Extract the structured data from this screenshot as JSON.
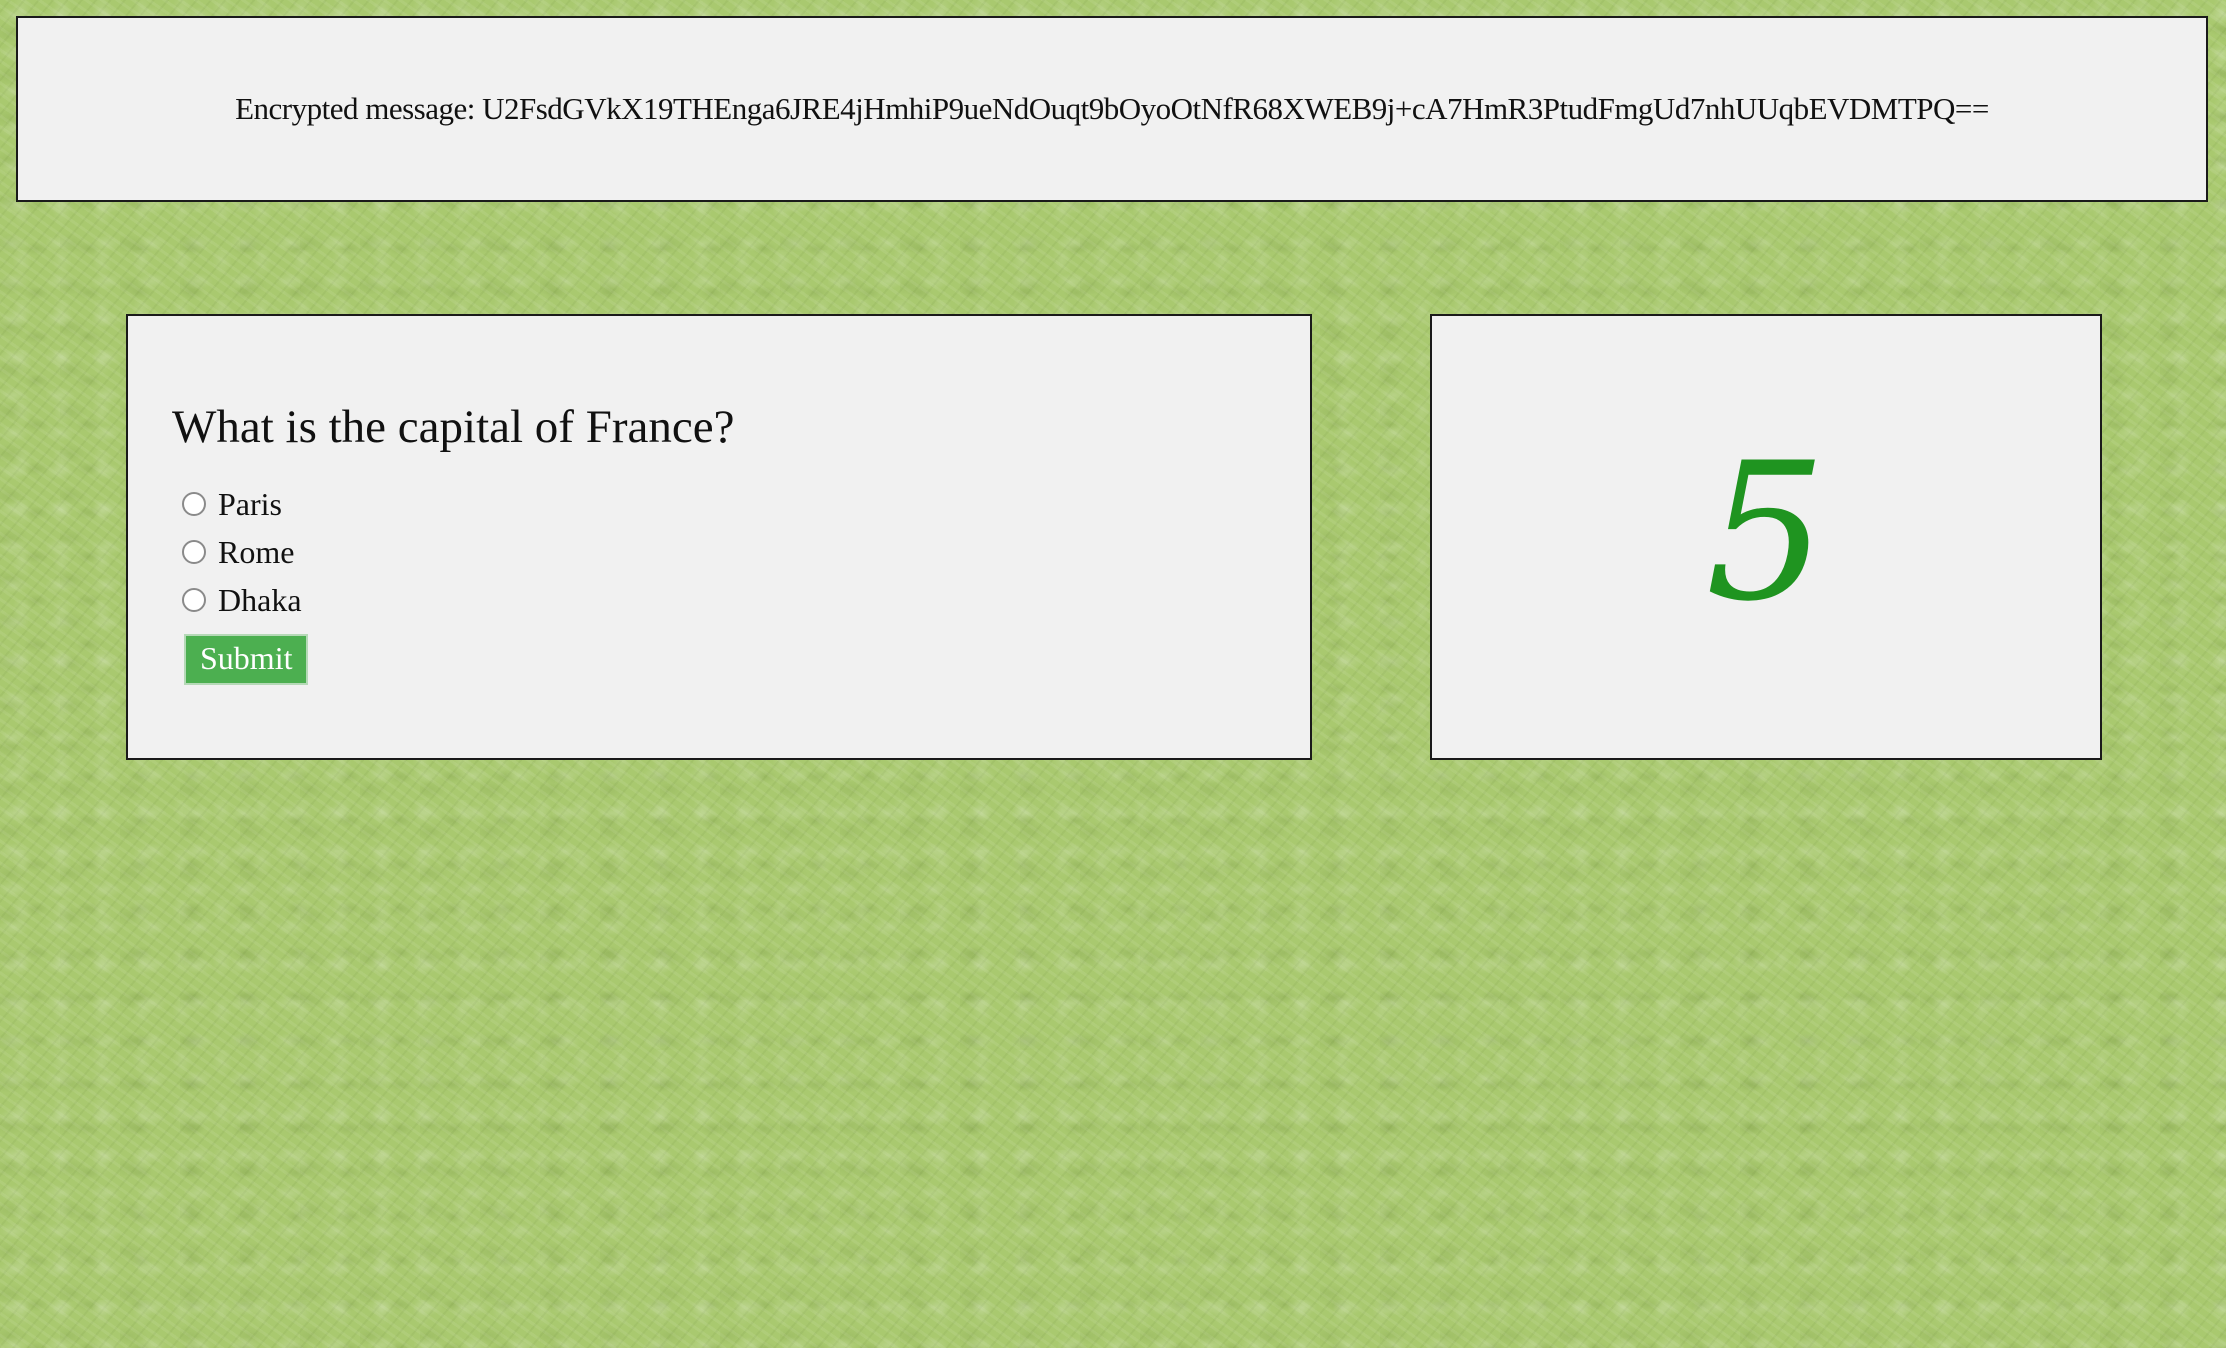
{
  "banner": {
    "text": "Encrypted message: U2FsdGVkX19THEnga6JRE4jHmhiP9ueNdOuqt9bOyoOtNfR68XWEB9j+cA7HmR3PtudFmgUd7nhUUqbEVDMTPQ=="
  },
  "quiz": {
    "question": "What is the capital of France?",
    "options": [
      {
        "label": "Paris"
      },
      {
        "label": "Rome"
      },
      {
        "label": "Dhaka"
      }
    ],
    "submit_label": "Submit"
  },
  "number_card": {
    "value": "5",
    "color": "#1f9420"
  },
  "colors": {
    "page_background": "#a9c96f",
    "card_background": "#f1f1f1",
    "submit_button": "#4caf50"
  }
}
